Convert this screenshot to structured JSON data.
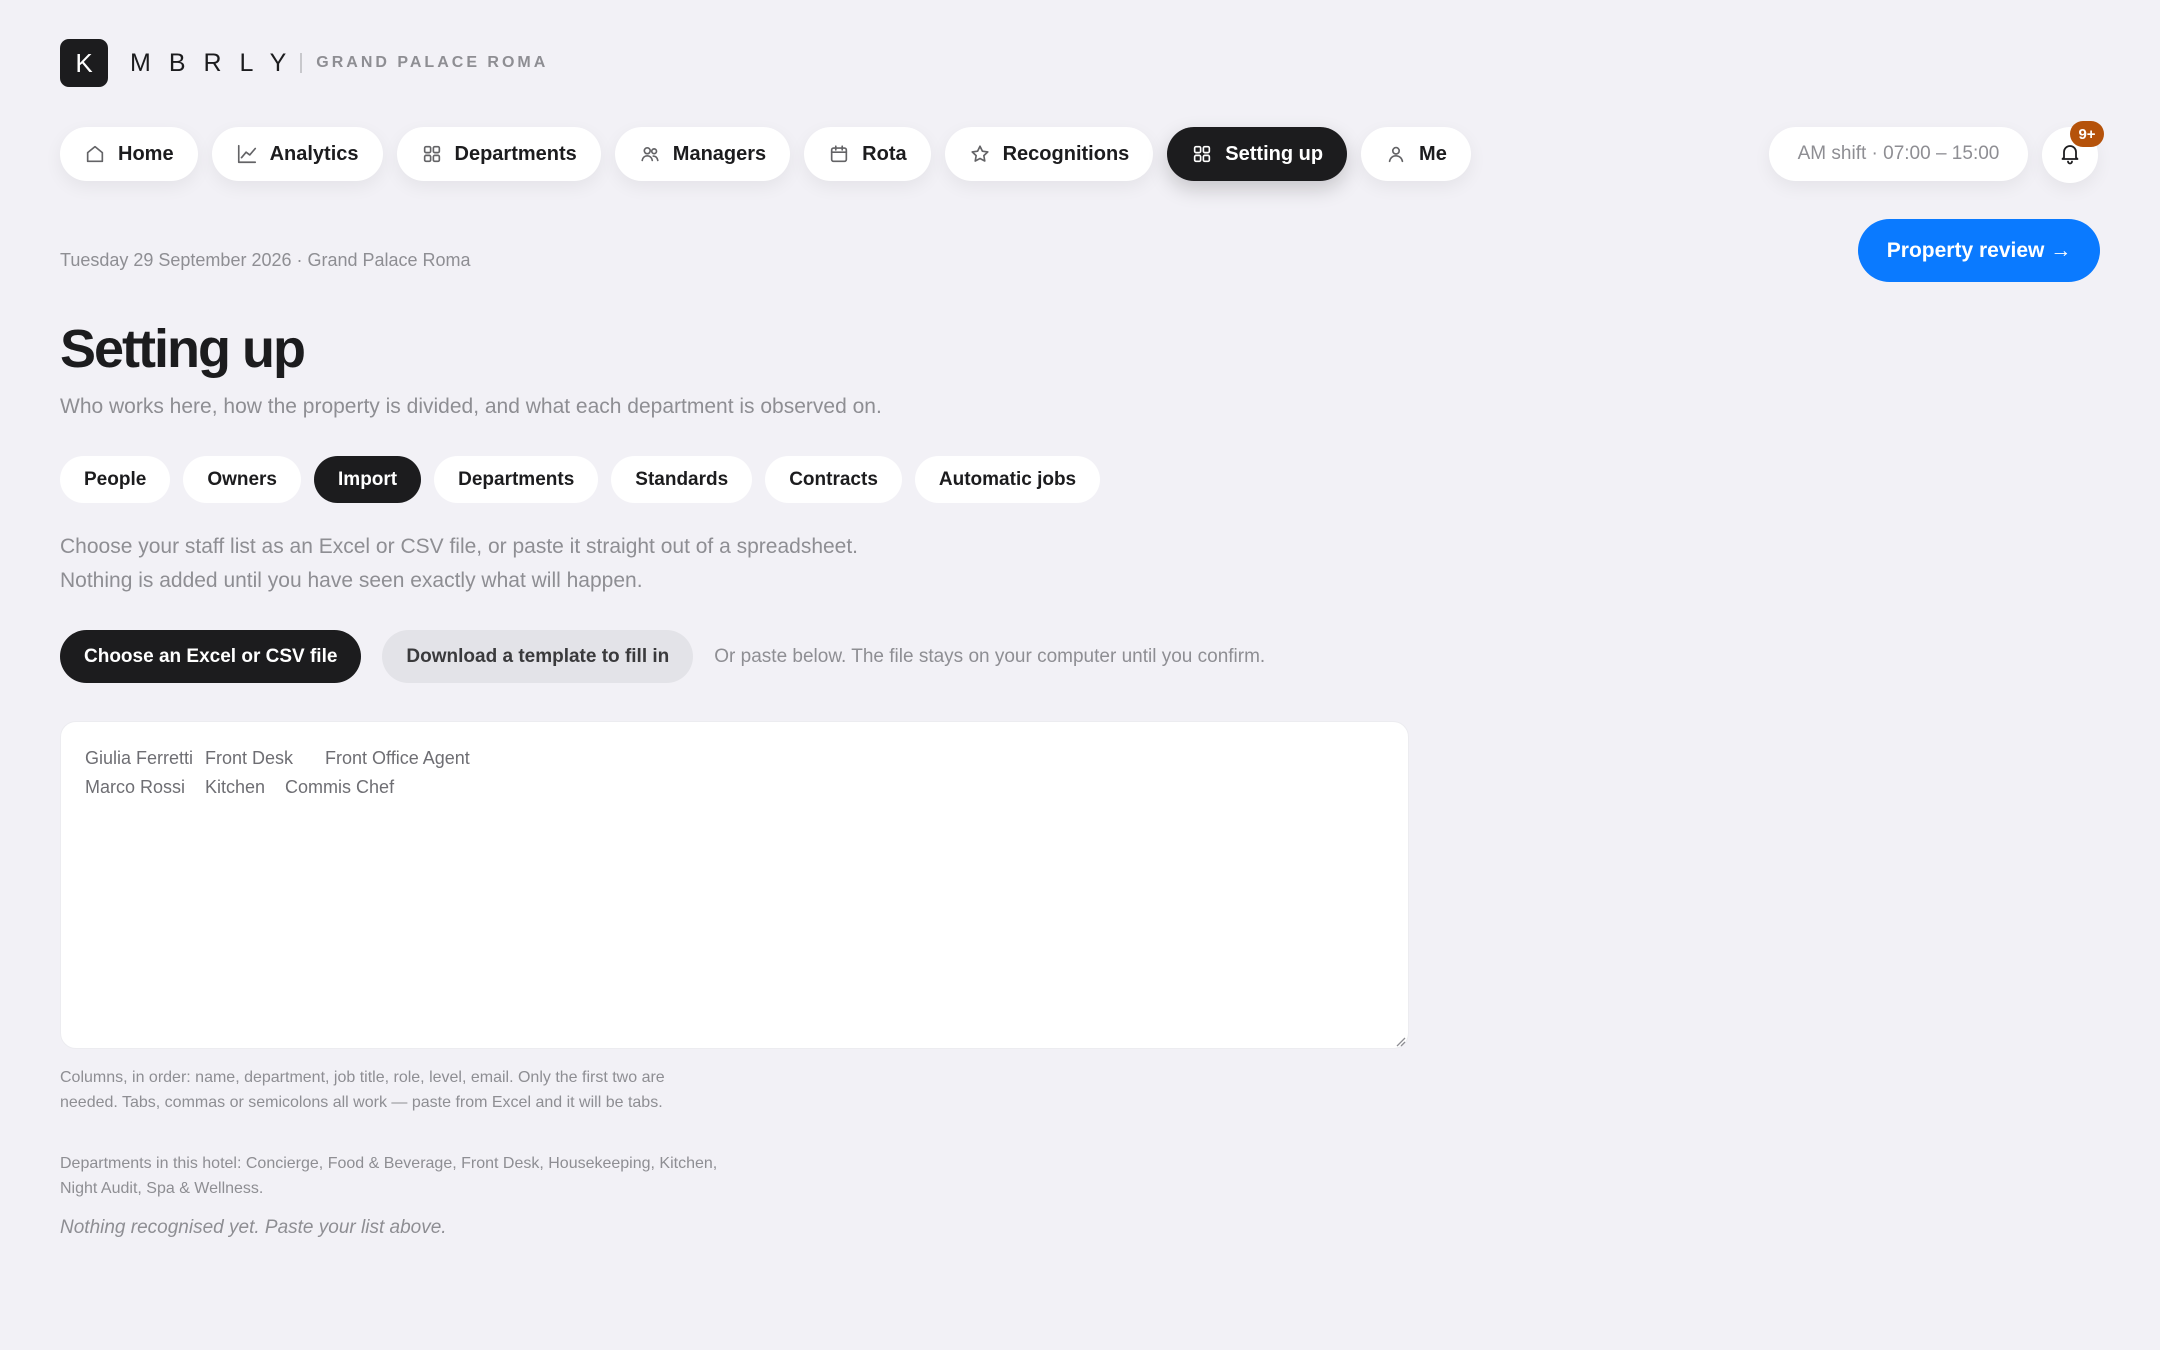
{
  "brand": {
    "mark": "K",
    "name": "MBRLY",
    "property": "GRAND PALACE ROMA"
  },
  "nav": {
    "items": [
      {
        "label": "Home",
        "icon": "home-icon"
      },
      {
        "label": "Analytics",
        "icon": "chart-icon"
      },
      {
        "label": "Departments",
        "icon": "grid-icon"
      },
      {
        "label": "Managers",
        "icon": "people-icon"
      },
      {
        "label": "Rota",
        "icon": "calendar-icon"
      },
      {
        "label": "Recognitions",
        "icon": "star-icon"
      },
      {
        "label": "Setting up",
        "icon": "grid-icon",
        "active": true
      },
      {
        "label": "Me",
        "icon": "person-icon"
      }
    ]
  },
  "shift": {
    "label": "AM shift · 07:00 – 15:00"
  },
  "notifications": {
    "badge": "9+",
    "icon": "bell-icon"
  },
  "review_button": {
    "label": "Property review →"
  },
  "date_line": "Tuesday 29 September 2026 · Grand Palace Roma",
  "page": {
    "title": "Setting up",
    "subtitle": "Who works here, how the property is divided, and what each department is observed on."
  },
  "tabs": {
    "items": [
      {
        "label": "People"
      },
      {
        "label": "Owners"
      },
      {
        "label": "Import",
        "active": true
      },
      {
        "label": "Departments"
      },
      {
        "label": "Standards"
      },
      {
        "label": "Contracts"
      },
      {
        "label": "Automatic jobs"
      }
    ]
  },
  "import": {
    "intro_line_1": "Choose your staff list as an Excel or CSV file, or paste it straight out of a spreadsheet.",
    "intro_line_2": "Nothing is added until you have seen exactly what will happen.",
    "choose_file_label": "Choose an Excel or CSV file",
    "download_template_label": "Download a template to fill in",
    "paste_note": "Or paste below. The file stays on your computer until you confirm.",
    "paste_lines": [
      "Giulia Ferretti\tFront Desk\tFront Office Agent",
      "Marco Rossi\tKitchen\tCommis Chef"
    ],
    "help_columns": "Columns, in order: name, department, job title, role, level, email. Only the first two are needed. Tabs, commas or semicolons all work — paste from Excel and it will be tabs.",
    "help_departments": "Departments in this hotel: Concierge, Food & Beverage, Front Desk, Housekeeping, Kitchen, Night Audit, Spa & Wellness.",
    "status": "Nothing recognised yet. Paste your list above."
  },
  "colors": {
    "background": "#f2f1f6",
    "dark": "#1c1c1e",
    "accent_blue": "#0a7aff",
    "badge_orange": "#b5520a",
    "muted_text": "#8e8e93"
  }
}
